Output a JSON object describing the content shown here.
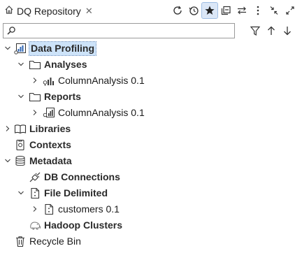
{
  "view": {
    "title": "DQ Repository",
    "close_glyph": "✕"
  },
  "toolbar": {
    "icons": [
      "refresh-icon",
      "history-icon",
      "favorite-star-icon",
      "collapse-all-icon",
      "link-with-editor-icon",
      "view-menu-icon",
      "minimize-icon",
      "maximize-icon"
    ]
  },
  "filter": {
    "value": "",
    "placeholder": ""
  },
  "tree": {
    "data_profiling": "Data Profiling",
    "analyses": "Analyses",
    "analysis_item": "ColumnAnalysis 0.1",
    "reports": "Reports",
    "report_item": "ColumnAnalysis 0.1",
    "libraries": "Libraries",
    "contexts": "Contexts",
    "metadata": "Metadata",
    "db_connections": "DB Connections",
    "file_delimited": "File Delimited",
    "customers": "customers 0.1",
    "hadoop_clusters": "Hadoop Clusters",
    "recycle_bin": "Recycle Bin"
  },
  "colors": {
    "selection": "#cde3f9",
    "accent": "#2f66b3"
  }
}
